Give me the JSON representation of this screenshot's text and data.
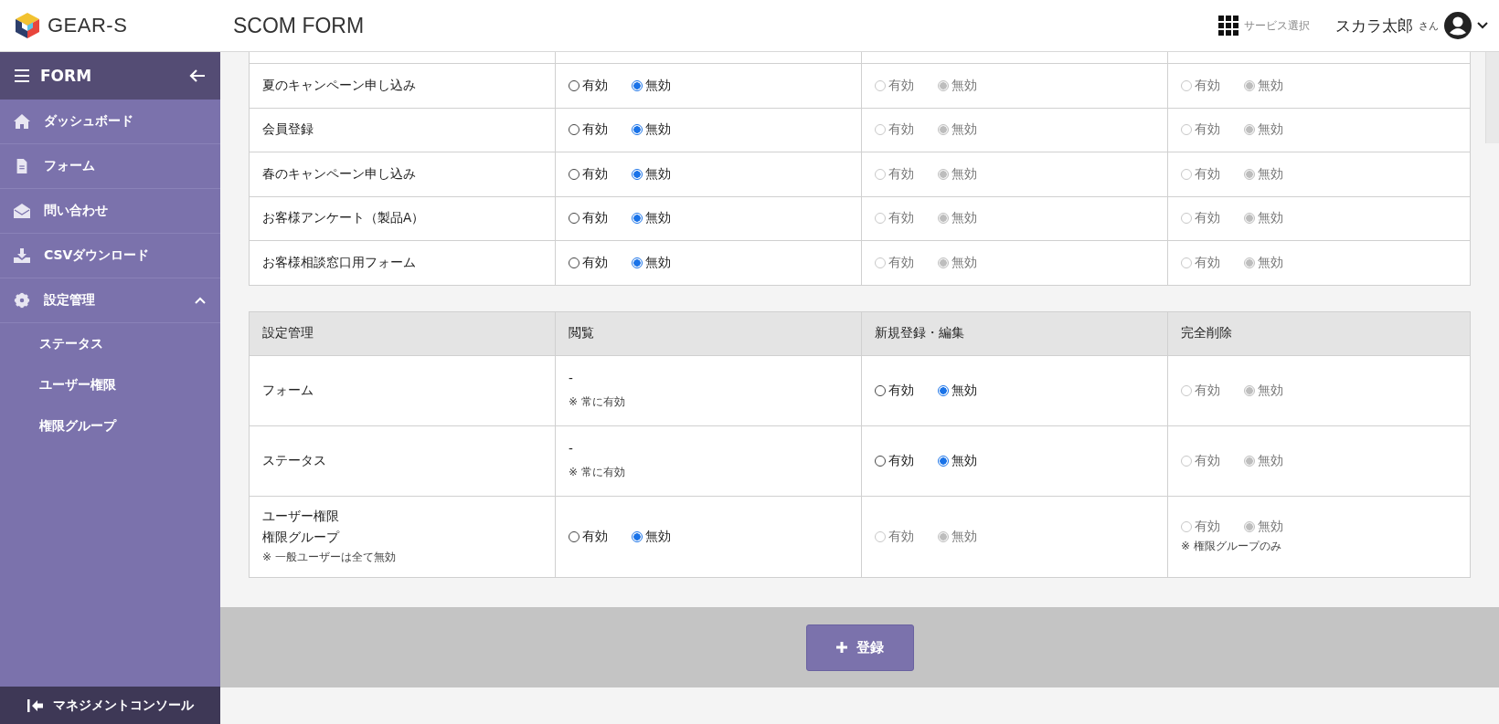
{
  "header": {
    "brand": "GEAR-S",
    "title": "SCOM FORM",
    "service_select": "サービス選択",
    "user_name": "スカラ太郎",
    "user_suffix": "さん"
  },
  "sidebar": {
    "title": "FORM",
    "items": [
      {
        "label": "ダッシュボード"
      },
      {
        "label": "フォーム"
      },
      {
        "label": "問い合わせ"
      },
      {
        "label": "CSVダウンロード"
      },
      {
        "label": "設定管理",
        "expanded": true,
        "children": [
          {
            "label": "ステータス"
          },
          {
            "label": "ユーザー権限"
          },
          {
            "label": "権限グループ"
          }
        ]
      }
    ],
    "footer": "マネジメントコンソール"
  },
  "form_table": {
    "rows": [
      {
        "label": "夏のキャンペーン申し込み",
        "cells": [
          {
            "kind": "radio",
            "disabled": false,
            "options": [
              {
                "label": "有効",
                "selected": false
              },
              {
                "label": "無効",
                "selected": true
              }
            ]
          },
          {
            "kind": "radio",
            "disabled": true,
            "options": [
              {
                "label": "有効",
                "selected": false
              },
              {
                "label": "無効",
                "selected": true
              }
            ]
          },
          {
            "kind": "radio",
            "disabled": true,
            "options": [
              {
                "label": "有効",
                "selected": false
              },
              {
                "label": "無効",
                "selected": true
              }
            ]
          }
        ]
      },
      {
        "label": "会員登録",
        "cells": [
          {
            "kind": "radio",
            "disabled": false,
            "options": [
              {
                "label": "有効",
                "selected": false
              },
              {
                "label": "無効",
                "selected": true
              }
            ]
          },
          {
            "kind": "radio",
            "disabled": true,
            "options": [
              {
                "label": "有効",
                "selected": false
              },
              {
                "label": "無効",
                "selected": true
              }
            ]
          },
          {
            "kind": "radio",
            "disabled": true,
            "options": [
              {
                "label": "有効",
                "selected": false
              },
              {
                "label": "無効",
                "selected": true
              }
            ]
          }
        ]
      },
      {
        "label": "春のキャンペーン申し込み",
        "cells": [
          {
            "kind": "radio",
            "disabled": false,
            "options": [
              {
                "label": "有効",
                "selected": false
              },
              {
                "label": "無効",
                "selected": true
              }
            ]
          },
          {
            "kind": "radio",
            "disabled": true,
            "options": [
              {
                "label": "有効",
                "selected": false
              },
              {
                "label": "無効",
                "selected": true
              }
            ]
          },
          {
            "kind": "radio",
            "disabled": true,
            "options": [
              {
                "label": "有効",
                "selected": false
              },
              {
                "label": "無効",
                "selected": true
              }
            ]
          }
        ]
      },
      {
        "label": "お客様アンケート（製品A）",
        "cells": [
          {
            "kind": "radio",
            "disabled": false,
            "options": [
              {
                "label": "有効",
                "selected": false
              },
              {
                "label": "無効",
                "selected": true
              }
            ]
          },
          {
            "kind": "radio",
            "disabled": true,
            "options": [
              {
                "label": "有効",
                "selected": false
              },
              {
                "label": "無効",
                "selected": true
              }
            ]
          },
          {
            "kind": "radio",
            "disabled": true,
            "options": [
              {
                "label": "有効",
                "selected": false
              },
              {
                "label": "無効",
                "selected": true
              }
            ]
          }
        ]
      },
      {
        "label": "お客様相談窓口用フォーム",
        "cells": [
          {
            "kind": "radio",
            "disabled": false,
            "options": [
              {
                "label": "有効",
                "selected": false
              },
              {
                "label": "無効",
                "selected": true
              }
            ]
          },
          {
            "kind": "radio",
            "disabled": true,
            "options": [
              {
                "label": "有効",
                "selected": false
              },
              {
                "label": "無効",
                "selected": true
              }
            ]
          },
          {
            "kind": "radio",
            "disabled": true,
            "options": [
              {
                "label": "有効",
                "selected": false
              },
              {
                "label": "無効",
                "selected": true
              }
            ]
          }
        ]
      }
    ]
  },
  "settings_table": {
    "columns": [
      "設定管理",
      "閲覧",
      "新規登録・編集",
      "完全削除"
    ],
    "rows": [
      {
        "cells": [
          {
            "kind": "label",
            "lines": [
              "フォーム"
            ]
          },
          {
            "kind": "text",
            "text": "-",
            "note": "※ 常に有効"
          },
          {
            "kind": "radio",
            "disabled": false,
            "options": [
              {
                "label": "有効",
                "selected": false
              },
              {
                "label": "無効",
                "selected": true
              }
            ]
          },
          {
            "kind": "radio",
            "disabled": true,
            "options": [
              {
                "label": "有効",
                "selected": false
              },
              {
                "label": "無効",
                "selected": true
              }
            ]
          }
        ]
      },
      {
        "cells": [
          {
            "kind": "label",
            "lines": [
              "ステータス"
            ]
          },
          {
            "kind": "text",
            "text": "-",
            "note": "※ 常に有効"
          },
          {
            "kind": "radio",
            "disabled": false,
            "options": [
              {
                "label": "有効",
                "selected": false
              },
              {
                "label": "無効",
                "selected": true
              }
            ]
          },
          {
            "kind": "radio",
            "disabled": true,
            "options": [
              {
                "label": "有効",
                "selected": false
              },
              {
                "label": "無効",
                "selected": true
              }
            ]
          }
        ]
      },
      {
        "cells": [
          {
            "kind": "label",
            "lines": [
              "ユーザー権限",
              "権限グループ"
            ],
            "note": "※ 一般ユーザーは全て無効"
          },
          {
            "kind": "radio",
            "disabled": false,
            "options": [
              {
                "label": "有効",
                "selected": false
              },
              {
                "label": "無効",
                "selected": true
              }
            ]
          },
          {
            "kind": "radio",
            "disabled": true,
            "options": [
              {
                "label": "有効",
                "selected": false
              },
              {
                "label": "無効",
                "selected": true
              }
            ]
          },
          {
            "kind": "radio",
            "disabled": true,
            "note": "※ 権限グループのみ",
            "options": [
              {
                "label": "有効",
                "selected": false
              },
              {
                "label": "無効",
                "selected": true
              }
            ]
          }
        ]
      }
    ]
  },
  "submit_button": "登録"
}
